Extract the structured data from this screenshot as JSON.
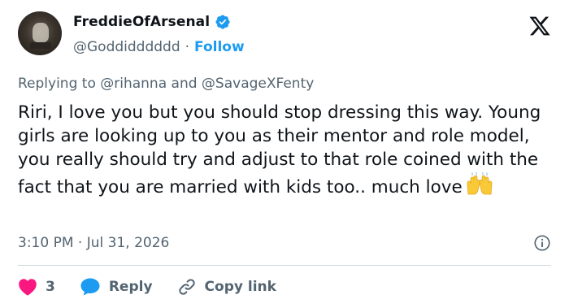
{
  "tweet": {
    "display_name": "FreddieOfArsenal",
    "handle": "@Goddidddddd",
    "separator": "·",
    "follow_label": "Follow",
    "reply_prefix": "Replying to",
    "reply_mentions": [
      "@rihanna",
      "@SavageXFenty"
    ],
    "reply_join": "and",
    "text": "Riri, I love you but you should stop dressing this way. Young girls are looking up to you as their mentor and role model, you really should try and adjust to that role coined with the fact that you are married with kids too.. much love",
    "emoji": "raising-hands",
    "time": "3:10 PM",
    "date": "Jul 31, 2026",
    "like_count": "3",
    "reply_label": "Reply",
    "copy_link_label": "Copy link"
  },
  "icons": {
    "verified": "verified-badge-icon",
    "brand": "x-logo-icon",
    "info": "info-icon",
    "like": "heart-icon",
    "reply": "speech-bubble-icon",
    "link": "link-icon"
  },
  "colors": {
    "accent": "#1d9bf0",
    "like": "#f91880",
    "secondary_text": "#536471",
    "primary_text": "#0f1419",
    "divider": "#cfd9de"
  }
}
